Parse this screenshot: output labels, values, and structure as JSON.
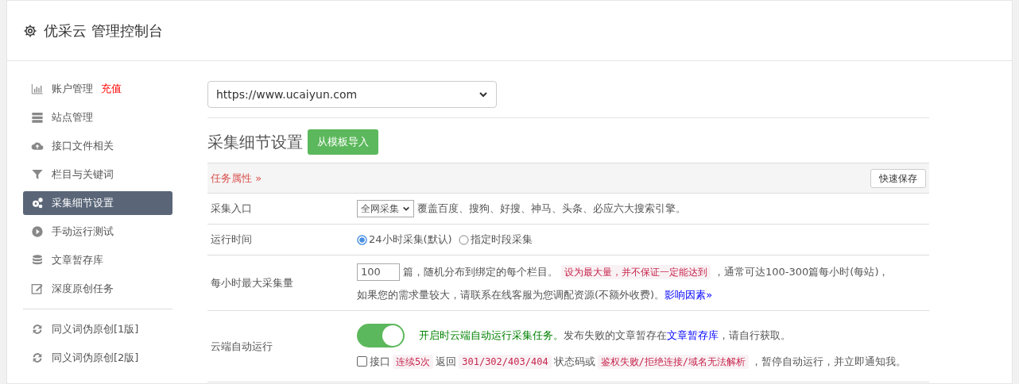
{
  "header": {
    "title": "优采云 管理控制台"
  },
  "sidebar": {
    "groups": [
      [
        {
          "label": "账户管理",
          "badge": "充值",
          "kind": "chart",
          "selected": false
        },
        {
          "label": "站点管理",
          "kind": "server",
          "selected": false
        },
        {
          "label": "接口文件相关",
          "kind": "cloud",
          "selected": false
        },
        {
          "label": "栏目与关键词",
          "kind": "filter",
          "selected": false
        },
        {
          "label": "采集细节设置",
          "kind": "gears",
          "selected": true
        },
        {
          "label": "手动运行测试",
          "kind": "play",
          "selected": false
        },
        {
          "label": "文章暂存库",
          "kind": "database",
          "selected": false
        },
        {
          "label": "深度原创任务",
          "kind": "edit",
          "selected": false
        }
      ],
      [
        {
          "label": "同义词伪原创[1版]",
          "kind": "refresh",
          "selected": false
        },
        {
          "label": "同义词伪原创[2版]",
          "kind": "refresh",
          "selected": false
        }
      ]
    ]
  },
  "site_select": {
    "value": "https://www.ucaiyun.com"
  },
  "section": {
    "title": "采集细节设置",
    "import_button": "从模板导入"
  },
  "panel": {
    "title": "任务属性 »",
    "save_button": "快速保存",
    "rows": [
      {
        "label": "采集入口",
        "kind": "select",
        "select": "全网采集",
        "note": "覆盖百度、搜狗、好搜、神马、头条、必应六大搜索引擎。"
      },
      {
        "label": "运行时间",
        "kind": "radios",
        "options": [
          {
            "label": "24小时采集(默认)",
            "selected": true
          },
          {
            "label": "指定时段采集",
            "selected": false
          }
        ]
      },
      {
        "label": "每小时最大采集量",
        "kind": "quota",
        "value": "100",
        "unit": "篇，随机分布到绑定的每个栏目。",
        "tag": "设为最大量，并不保证一定能达到",
        "after": "，通常可达100-300篇每小时(每站)，",
        "line2": "如果您的需求量较大，请联系在线客服为您调配资源(不额外收费)。",
        "link": "影响因素»"
      },
      {
        "label": "云端自动运行",
        "kind": "auto",
        "on": true,
        "desc": "开启时云端自动运行采集任务。",
        "desc2": "发布失败的文章暂存在",
        "link": "文章暂存库",
        "desc3": "，请自行获取。",
        "check": {
          "checked": false,
          "parts": [
            "接口",
            "连续5次",
            "返回",
            "301/302/403/404",
            "状态码或",
            "鉴权失败/拒绝连接/域名无法解析",
            "，暂停自动运行，并立即通知我。"
          ]
        }
      }
    ]
  }
}
